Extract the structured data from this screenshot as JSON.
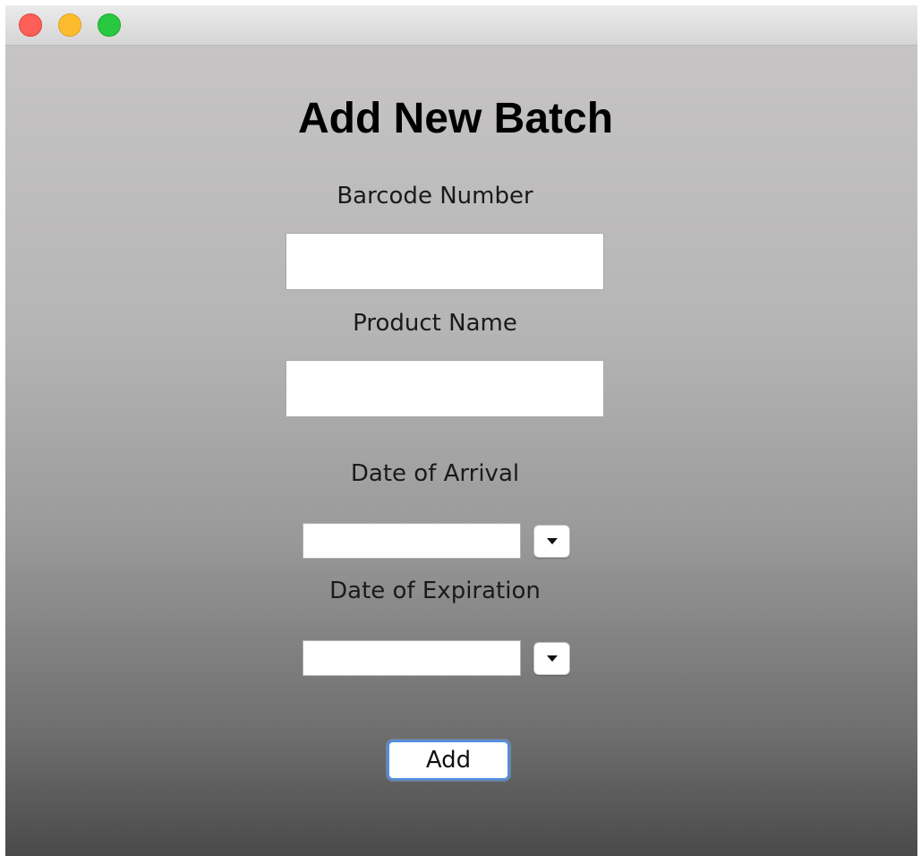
{
  "window": {
    "controls": [
      "close",
      "minimize",
      "zoom"
    ]
  },
  "form": {
    "title": "Add New Batch",
    "barcode": {
      "label": "Barcode Number",
      "value": ""
    },
    "product": {
      "label": "Product Name",
      "value": ""
    },
    "arrival": {
      "label": "Date of Arrival",
      "value": "",
      "dropdown_icon": "caret-down-icon"
    },
    "expiration": {
      "label": "Date of Expiration",
      "value": "",
      "dropdown_icon": "caret-down-icon"
    },
    "submit_label": "Add"
  },
  "colors": {
    "close": "#fc5f57",
    "minimize": "#fdbc2e",
    "zoom": "#28c840",
    "focus_ring": "#4f8fe6"
  }
}
